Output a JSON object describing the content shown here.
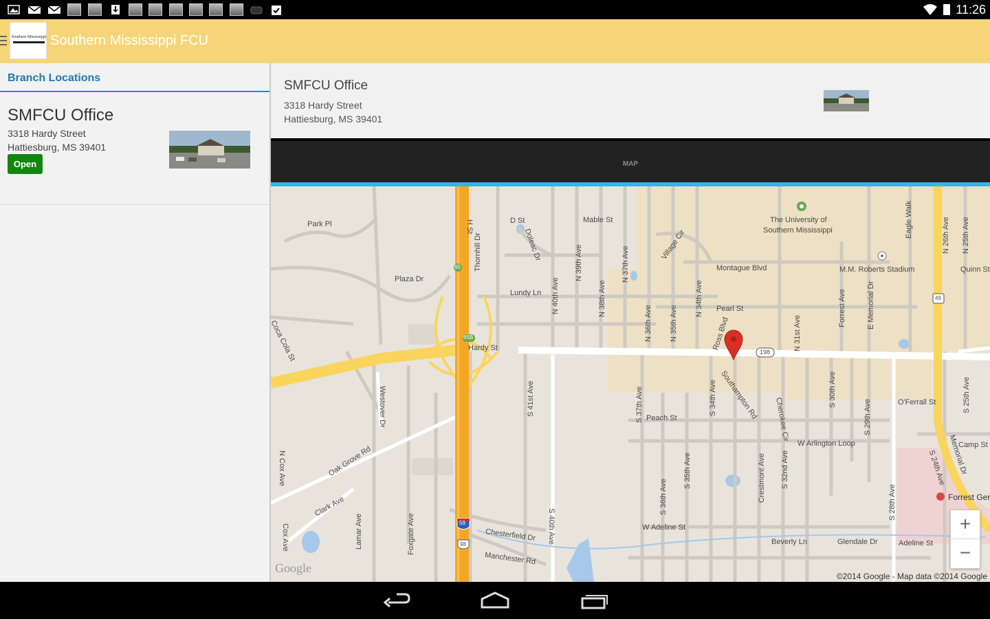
{
  "status_bar": {
    "clock": "11:26",
    "notification_icons": [
      "image-icon",
      "mail-icon",
      "mail-icon",
      "thumb-icon",
      "thumb-icon",
      "download-icon",
      "thumb-icon",
      "thumb-icon",
      "thumb-icon",
      "thumb-icon",
      "thumb-icon",
      "thumb-icon",
      "cloud-icon",
      "clipboard-check-icon"
    ],
    "wifi_icon": "wifi-icon",
    "battery_icon": "battery-icon"
  },
  "app_bar": {
    "title": "Southern Mississippi FCU",
    "logo_text": "Southern Mississippi",
    "menu_icon": "hamburger-icon",
    "color": "#f5d577"
  },
  "left_pane": {
    "header": "Branch Locations",
    "branches": [
      {
        "name": "SMFCU Office",
        "street": "3318 Hardy Street",
        "city": "Hattiesburg, MS  39401",
        "status": "Open",
        "status_color": "#12860f"
      }
    ]
  },
  "detail": {
    "name": "SMFCU Office",
    "street": "3318 Hardy Street",
    "city": "Hattiesburg, MS  39401"
  },
  "tabs": {
    "map": "MAP",
    "indicator_color": "#33b5e5"
  },
  "map": {
    "labels": {
      "park_pl": "Park Pl",
      "plaza_dr": "Plaza Dr",
      "coca_cola_st": "Coca Cola St",
      "d_st": "D St",
      "dolde_dr": "Doleac Dr",
      "mable_st": "Mable St",
      "lundy_ln": "Lundy Ln",
      "thornhill_dr": "Thornhill Dr",
      "h_st": "H St",
      "n_40th": "N 40th Ave",
      "n_39th": "N 39th Ave",
      "n_38th": "N 38th Ave",
      "n_37th": "N 37th Ave",
      "village_cir": "Village Cir",
      "university": "The University of",
      "university2": "Southern Mississippi",
      "montague": "Montague Blvd",
      "mm_roberts": "M.M. Roberts Stadium",
      "quinn_st": "Quinn St",
      "eagle_walk": "Eagle Walk",
      "n_26th": "N 26th Ave",
      "n_25th": "N 25th Ave",
      "pearl_st": "Pearl St",
      "n_36th": "N 36th Ave",
      "n_35th": "N 35th Ave",
      "n_34th": "N 34th Ave",
      "ross_blvd": "Ross Blvd",
      "n_31st": "N 31st Ave",
      "forrest_ave": "Forrest Ave",
      "e_memorial": "E Memorial Dr",
      "hardy_st": "Hardy St",
      "hwy_198": "198",
      "hwy_65": "65",
      "hwy_65b": "65B",
      "hwy_49": "49",
      "hwy_59": "59",
      "hwy_98": "98",
      "westover": "Westover Dr",
      "s_41st": "S 41st Ave",
      "s_37th": "S 37th Ave",
      "peach_st": "Peach St",
      "s_34th": "S 34th Ave",
      "southampton": "Southampton Rd",
      "cherokee": "Cherokee Cir",
      "s_30th": "S 30th Ave",
      "s_29th": "S 29th Ave",
      "ofarrell": "O'Ferrall St",
      "s_25th": "S 25th Ave",
      "w_arlington": "W Arlington Loop",
      "camp_st": "Camp St",
      "memorial_dr": "Memorial Dr",
      "s_24th": "S 24th Ave",
      "n_cox": "N Cox Ave",
      "oak_grove": "Oak Grove Rd",
      "s_35th": "S 35th Ave",
      "crestmont": "Crestmont Ave",
      "s_32nd": "S 32nd Ave",
      "s_36th": "S 36th Ave",
      "s_28th": "S 28th Ave",
      "forrest_gen": "Forrest Ger",
      "clark_ave": "Clark Ave",
      "lamar_ave": "Lamar Ave",
      "foxgate": "Foxgate Ave",
      "s_40th": "S 40th Ave",
      "chesterfield": "Chesterfield Dr",
      "manchester": "Manchester Rd",
      "w_adeline": "W Adeline St",
      "beverly_ln": "Beverly Ln",
      "glendale": "Glendale Dr",
      "adeline_st": "Adeline St",
      "cox_ave": "Cox Ave"
    },
    "zoom_in": "+",
    "zoom_out": "−",
    "google": "Google",
    "copyright": "©2014 Google - Map data ©2014 Google",
    "pin_color": "#d93025"
  },
  "nav": {
    "back_icon": "back-icon",
    "home_icon": "home-icon",
    "recents_icon": "recents-icon"
  }
}
